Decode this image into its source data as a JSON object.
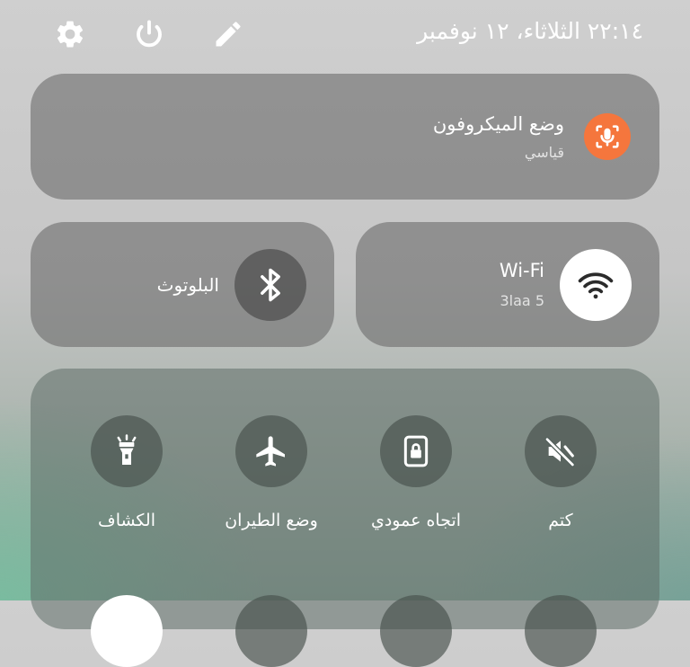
{
  "status_bar": {
    "datetime": "٢٢:١٤ الثلاثاء، ١٢ نوفمبر",
    "icons": [
      "gear-icon",
      "power-icon",
      "edit-pencil-icon"
    ]
  },
  "microphone": {
    "title": "وضع الميكروفون",
    "mode": "قياسي",
    "badge_color": "#f5763d",
    "icon": "microphone-icon"
  },
  "bluetooth": {
    "label": "البلوتوث",
    "icon": "bluetooth-icon",
    "active": false
  },
  "wifi": {
    "label": "Wi-Fi",
    "network": "3laa 5",
    "icon": "wifi-icon",
    "active": true
  },
  "toggles": [
    {
      "label": "الكشاف",
      "icon": "flashlight-icon"
    },
    {
      "label": "وضع الطيران",
      "icon": "airplane-icon"
    },
    {
      "label": "اتجاه عمودي",
      "icon": "portrait-lock-icon"
    },
    {
      "label": "كتم",
      "icon": "mute-icon"
    }
  ],
  "colors": {
    "tile_bg": "#6e6e6e",
    "accent_orange": "#f5763d",
    "active_circle": "#ffffff"
  }
}
